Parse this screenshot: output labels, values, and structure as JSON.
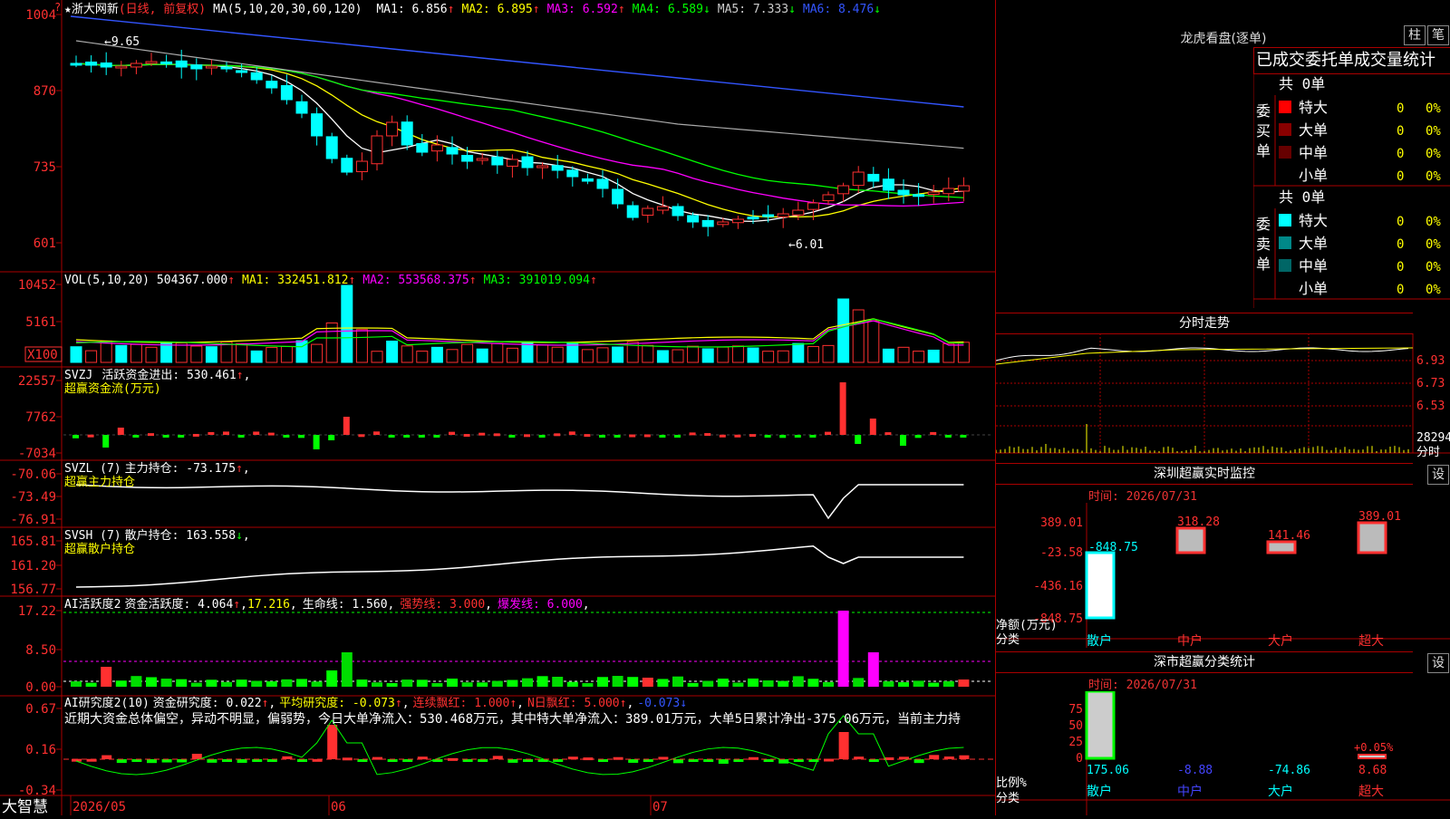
{
  "colors": {
    "up": "#ff3030",
    "down": "#00ffff",
    "ma1": "#ffffff",
    "ma2": "#ffff00",
    "ma3": "#ff00ff",
    "ma4": "#00ff00",
    "ma5": "#aaaaaa",
    "ma6": "#3355ff",
    "grid": "#aa0000",
    "label": "#ff3030"
  },
  "main": {
    "name": "★浙大网新",
    "mode": "(日线, 前复权)",
    "ma_def": "MA(5,10,20,30,60,120)",
    "legend": [
      {
        "label": "MA1: ",
        "value": "6.856",
        "arrow": "↑",
        "color": "#ffffff"
      },
      {
        "label": "MA2: ",
        "value": "6.895",
        "arrow": "↑",
        "color": "#ffff00"
      },
      {
        "label": "MA3: ",
        "value": "6.592",
        "arrow": "↑",
        "color": "#ff00ff"
      },
      {
        "label": "MA4: ",
        "value": "6.589",
        "arrow": "↓",
        "color": "#00ff00"
      },
      {
        "label": "MA5: ",
        "value": "7.333",
        "arrow": "↓",
        "color": "#cccccc"
      },
      {
        "label": "MA6: ",
        "value": "8.476",
        "arrow": "↓",
        "color": "#3355ff"
      }
    ],
    "yaxis": [
      "1004",
      "870",
      "735",
      "601"
    ],
    "high_label": "9.65",
    "low_label": "6.01"
  },
  "vol": {
    "title": "VOL(5,10,20)",
    "value": "504367.000",
    "legend": [
      {
        "label": "MA1: ",
        "value": "332451.812",
        "arrow": "↑",
        "color": "#ffff00"
      },
      {
        "label": "MA2: ",
        "value": "553568.375",
        "arrow": "↑",
        "color": "#ff00ff"
      },
      {
        "label": "MA3: ",
        "value": "391019.094",
        "arrow": "↑",
        "color": "#00ff00"
      }
    ],
    "yaxis": [
      "10452",
      "5161"
    ],
    "unit": "X100"
  },
  "svzj": {
    "title": "SVZJ",
    "label": "活跃资金进出: ",
    "value": "530.461",
    "arrow": "↑",
    "sub": "超赢资金流(万元)",
    "yaxis": [
      "22557",
      "7762",
      "-7034"
    ]
  },
  "svzl": {
    "title": "SVZL (7)",
    "label": "主力持仓: ",
    "value": "-73.175",
    "arrow": "↑",
    "sub": "超赢主力持仓",
    "yaxis": [
      "-70.06",
      "-73.49",
      "-76.91"
    ]
  },
  "svsh": {
    "title": "SVSH (7)",
    "label": "散户持仓: ",
    "value": "163.558",
    "arrow": "↓",
    "sub": "超赢散户持仓",
    "yaxis": [
      "165.81",
      "161.20",
      "156.77"
    ]
  },
  "ai1": {
    "title": "AI活跃度2",
    "label": "资金活跃度: ",
    "value": "4.064",
    "arrow": "↑",
    "v2": "17.216",
    "l3": "生命线: ",
    "v3": "1.560",
    "l4": "强势线: ",
    "v4": "3.000",
    "l5": "爆发线: ",
    "v5": "6.000",
    "yaxis": [
      "17.22",
      "8.50",
      "0.00"
    ]
  },
  "ai2": {
    "title": "AI研究度2(10)",
    "label": "资金研究度: ",
    "value": "0.022",
    "arrow": "↑",
    "l2": "平均研究度: ",
    "v2": "-0.073",
    "a2": "↑",
    "l3": "连续飘红: ",
    "v3": "1.000",
    "a3": "↑",
    "l4": "N日飘红: ",
    "v4": "5.000",
    "a4": "↑",
    "v5": "-0.073",
    "a5": "↓",
    "comment": "近期大资金总体偏空，异动不明显，偏弱势，今日大单净流入：530.468万元，其中特大单净流入：389.01万元，大单5日累计净出-375.06万元，当前主力持",
    "yaxis": [
      "0.67",
      "0.16",
      "-0.34"
    ]
  },
  "footer": {
    "brand": "大智慧",
    "dates": [
      "2026/05",
      "06",
      "07"
    ]
  },
  "longhu": {
    "title": "龙虎看盘(逐单)",
    "btn1": "柱",
    "btn2": "笔",
    "header": "已成交委托单成交量统计",
    "buy": {
      "side": "委买单",
      "total": "共 0单",
      "rows": [
        {
          "name": "特大",
          "count": "0",
          "pct": "0%",
          "color": "#ff0000"
        },
        {
          "name": "大单",
          "count": "0",
          "pct": "0%",
          "color": "#880000"
        },
        {
          "name": "中单",
          "count": "0",
          "pct": "0%",
          "color": "#660000"
        },
        {
          "name": "小单",
          "count": "0",
          "pct": "0%",
          "color": "#000000"
        }
      ]
    },
    "sell": {
      "side": "委卖单",
      "total": "共 0单",
      "rows": [
        {
          "name": "特大",
          "count": "0",
          "pct": "0%",
          "color": "#00ffff"
        },
        {
          "name": "大单",
          "count": "0",
          "pct": "0%",
          "color": "#008888"
        },
        {
          "name": "中单",
          "count": "0",
          "pct": "0%",
          "color": "#006666"
        },
        {
          "name": "小单",
          "count": "0",
          "pct": "0%",
          "color": "#000000"
        }
      ]
    }
  },
  "intraday": {
    "title": "分时走势",
    "yaxis": [
      "6.93",
      "6.73",
      "6.53"
    ],
    "vol": "28294",
    "vol_label": "分时"
  },
  "monitor": {
    "title": "深圳超赢实时监控",
    "btn": "设",
    "time": "时间: 2026/07/31",
    "yaxis": [
      "389.01",
      "-23.58",
      "-436.16",
      "-848.75"
    ],
    "ylabel": "净额(万元)",
    "xlabel": "分类",
    "bars": [
      {
        "cat": "散户",
        "value": -848.75,
        "label": "-848.75"
      },
      {
        "cat": "中户",
        "value": 318.28,
        "label": "318.28"
      },
      {
        "cat": "大户",
        "value": 141.46,
        "label": "141.46"
      },
      {
        "cat": "超大",
        "value": 389.01,
        "label": "389.01"
      }
    ]
  },
  "stats": {
    "title": "深市超赢分类统计",
    "btn": "设",
    "time": "时间: 2026/07/31",
    "yaxis": [
      "75",
      "50",
      "25",
      "0"
    ],
    "ylabel": "比例%",
    "xlabel": "分类",
    "annot": "+0.05%",
    "bars": [
      {
        "cat": "散户",
        "label": "175.06",
        "color": "#00ffff"
      },
      {
        "cat": "中户",
        "label": "-8.88",
        "color": "#4444ff"
      },
      {
        "cat": "大户",
        "label": "-74.86",
        "color": "#00ffff"
      },
      {
        "cat": "超大",
        "label": "8.68",
        "color": "#ff3030"
      }
    ]
  }
}
